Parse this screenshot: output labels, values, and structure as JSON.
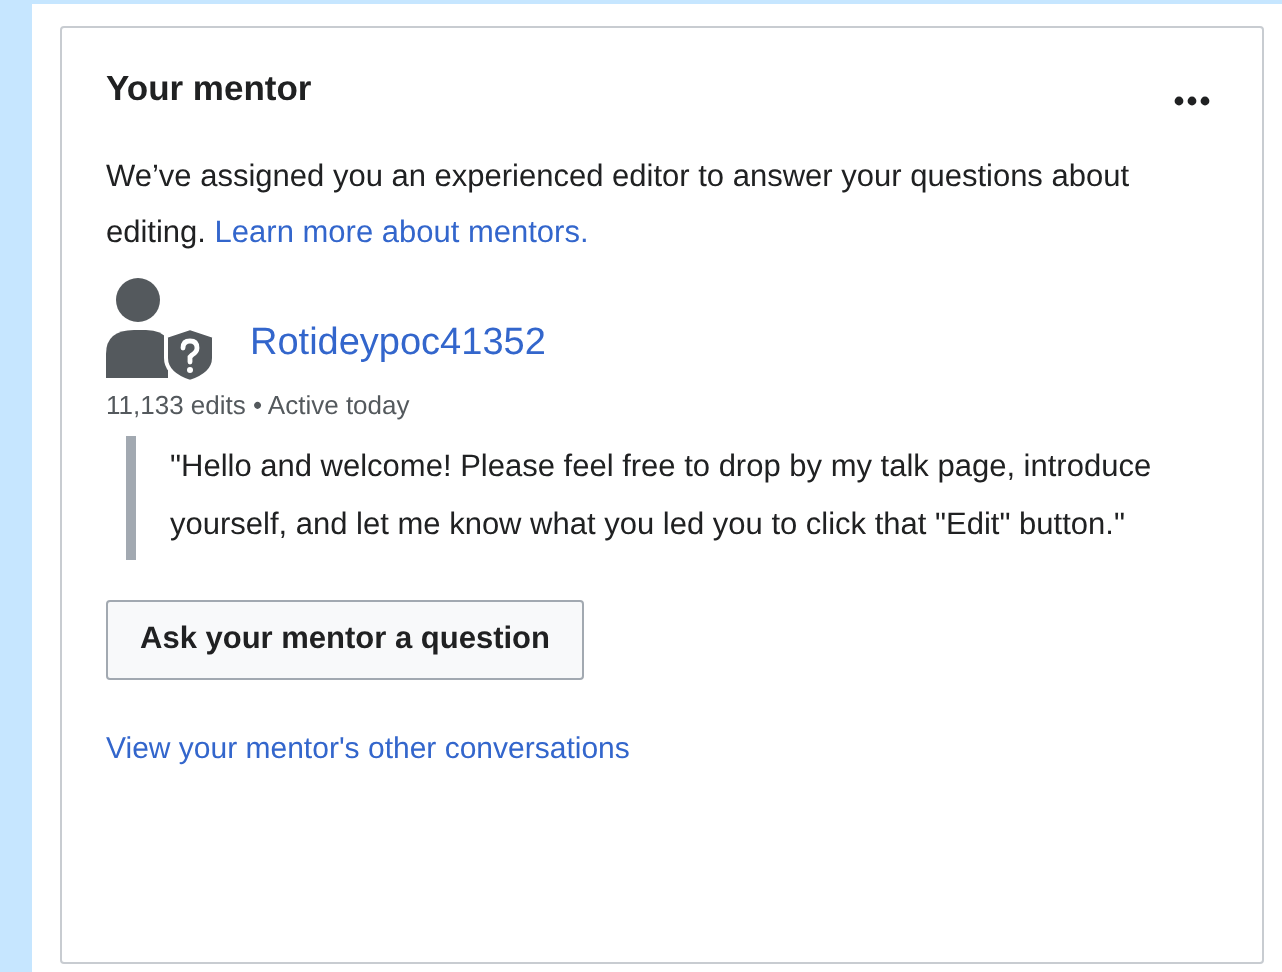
{
  "card": {
    "title": "Your mentor",
    "intro": "We’ve assigned you an experienced editor to answer your questions about editing.",
    "learn_more_link": "Learn more about mentors.",
    "mentor": {
      "name": "Rotideypoc41352",
      "stats": "11,133 edits • Active today"
    },
    "quote": "\"Hello and welcome! Please feel free to drop by my talk page, introduce yourself, and let me know what you led you to click that \"Edit\" button.\"",
    "ask_button": "Ask your mentor a question",
    "conversations_link": "View your mentor's other conversations"
  }
}
